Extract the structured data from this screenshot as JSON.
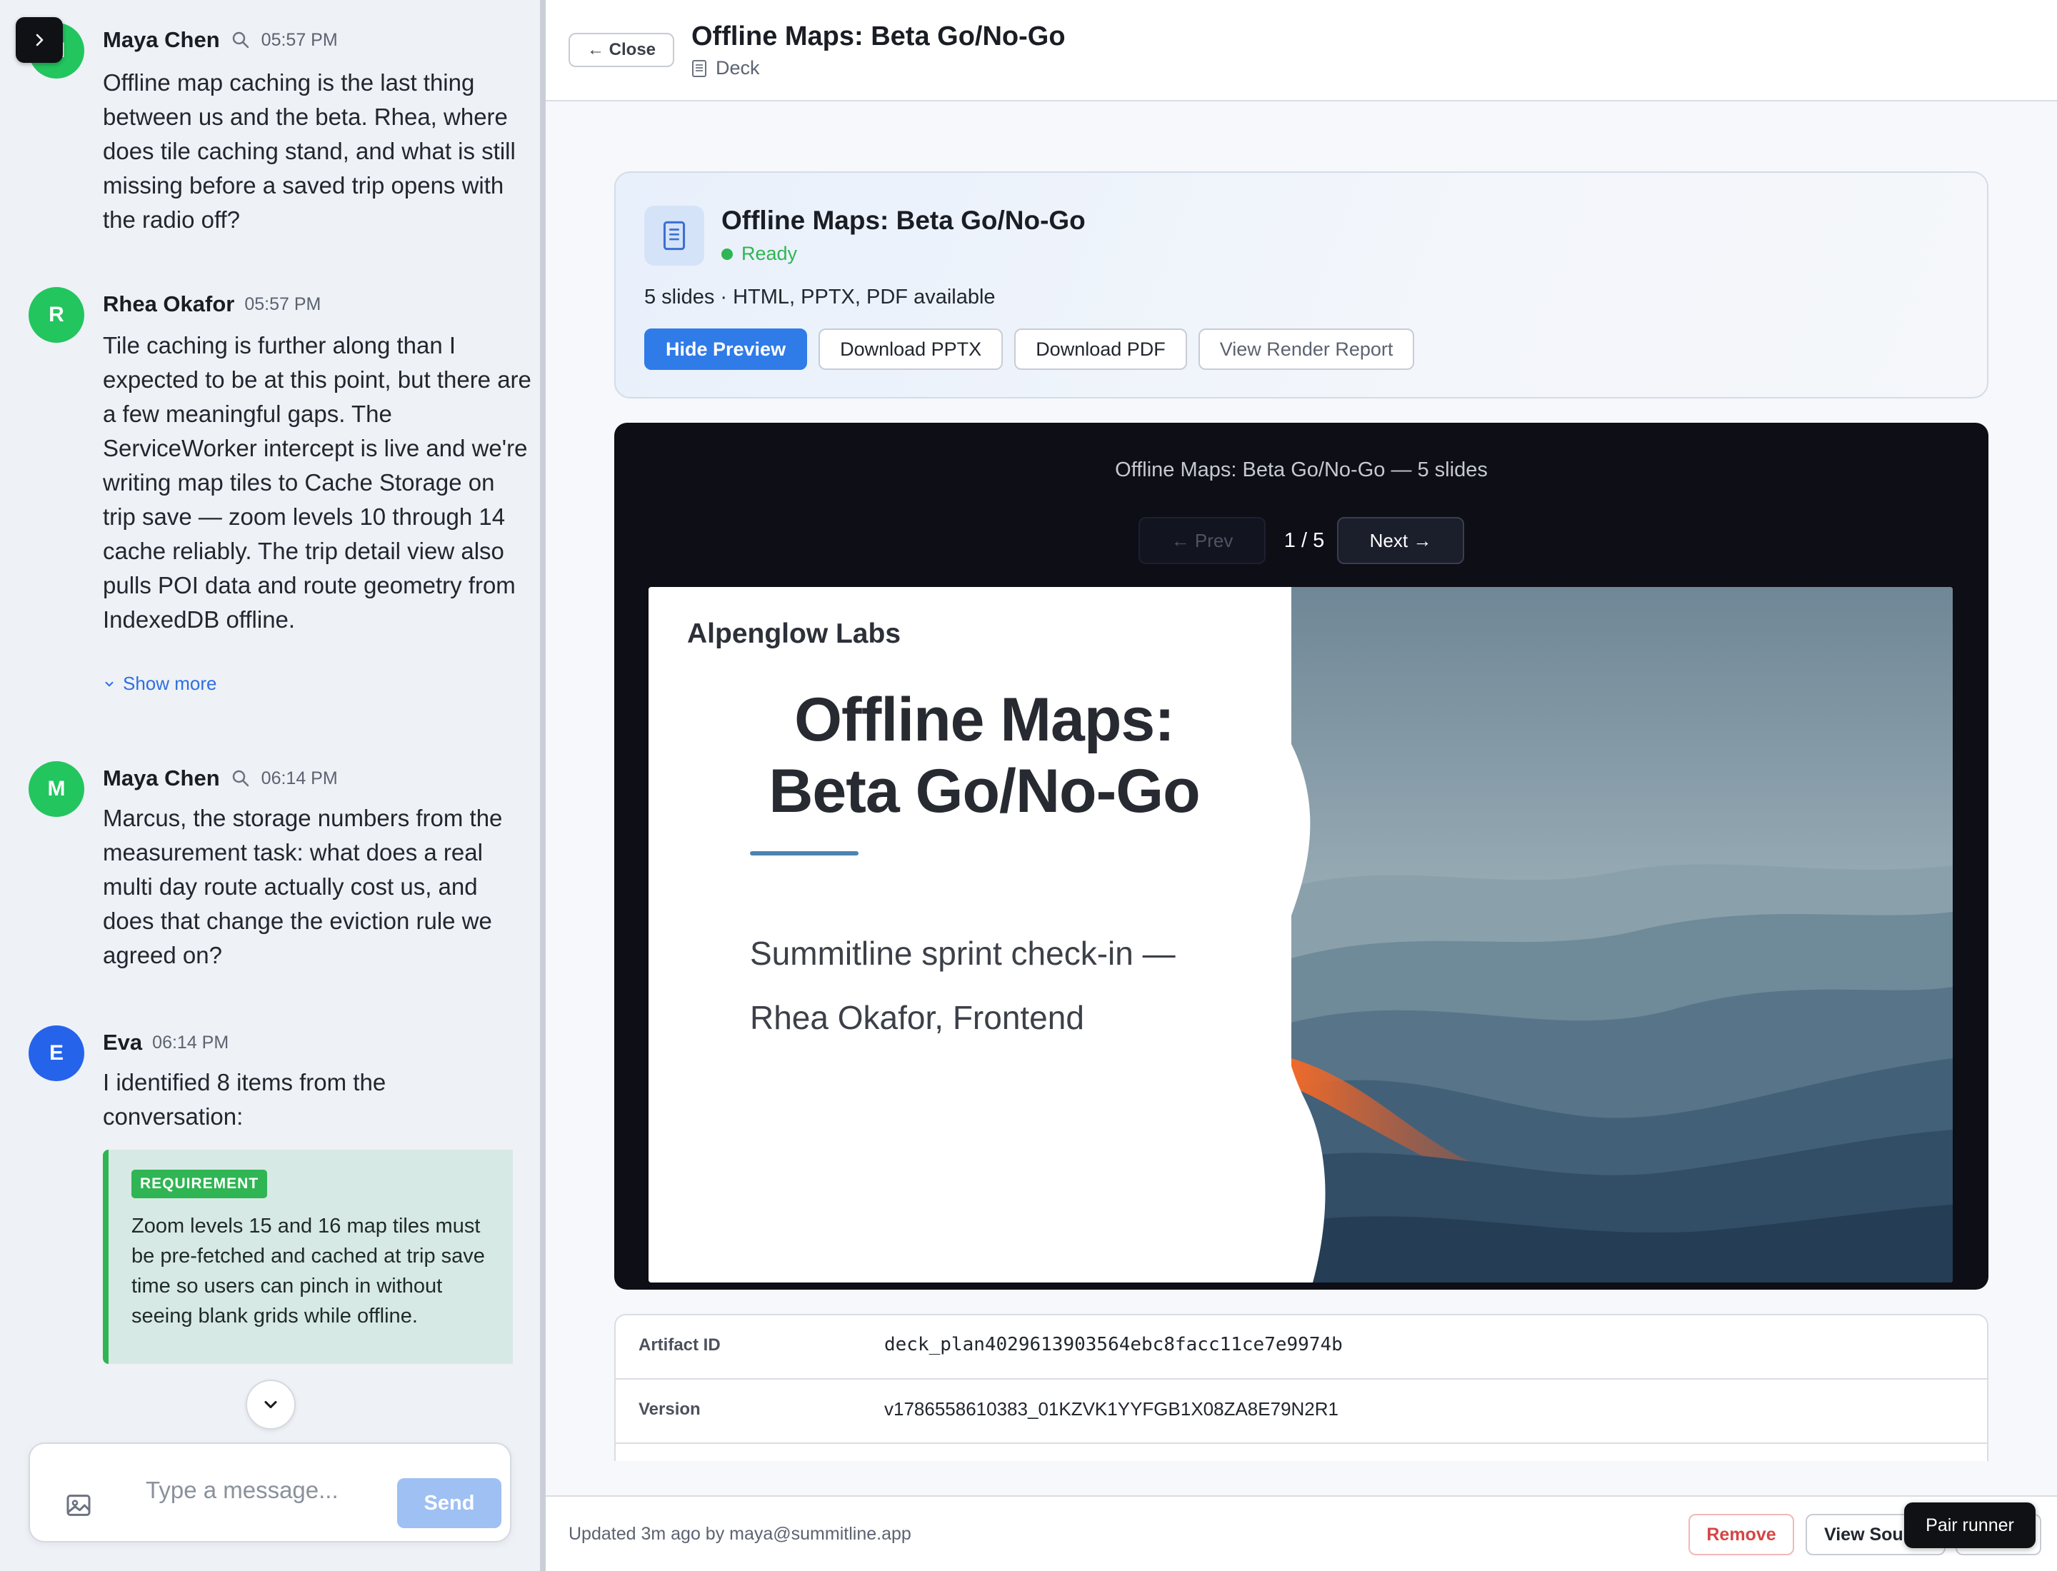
{
  "chat": {
    "messages": [
      {
        "author": "Maya Chen",
        "avatar": "M",
        "avatar_color": "#22c55e",
        "time": "05:57 PM",
        "text": "Offline map caching is the last thing between us and the beta. Rhea, where does tile caching stand, and what is still missing before a saved trip opens with the radio off?"
      },
      {
        "author": "Rhea Okafor",
        "avatar": "R",
        "avatar_color": "#22c55e",
        "time": "05:57 PM",
        "text": "Tile caching is further along than I expected to be at this point, but there are a few meaningful gaps. The ServiceWorker intercept is live and we're writing map tiles to Cache Storage on trip save — zoom levels 10 through 14 cache reliably. The trip detail view also pulls POI data and route geometry from IndexedDB offline.",
        "show_more": "Show more"
      },
      {
        "author": "Maya Chen",
        "avatar": "M",
        "avatar_color": "#22c55e",
        "time": "06:14 PM",
        "text": "Marcus, the storage numbers from the measurement task: what does a real multi day route actually cost us, and does that change the eviction rule we agreed on?"
      },
      {
        "author": "Eva",
        "avatar": "E",
        "avatar_color": "#2563eb",
        "time": "06:14 PM",
        "text": "I identified 8 items from the conversation:"
      }
    ],
    "requirement": {
      "badge": "REQUIREMENT",
      "text": "Zoom levels 15 and 16 map tiles must be pre-fetched and cached at trip save time so users can pinch in without seeing blank grids while offline."
    },
    "composer": {
      "placeholder": "Type a message...",
      "send_label": "Send"
    }
  },
  "header": {
    "close_label": "← Close",
    "title": "Offline Maps: Beta Go/No-Go",
    "type_label": "Deck"
  },
  "artifact": {
    "title": "Offline Maps: Beta Go/No-Go",
    "status": "Ready",
    "summary": "5 slides · HTML, PPTX, PDF available",
    "actions": {
      "hide_preview": "Hide Preview",
      "download_pptx": "Download PPTX",
      "download_pdf": "Download PDF",
      "view_render_report": "View Render Report"
    }
  },
  "viewer": {
    "title": "Offline Maps: Beta Go/No-Go — 5 slides",
    "prev_label": "← Prev",
    "next_label": "Next →",
    "page_indicator": "1 / 5",
    "slide": {
      "brand": "Alpenglow Labs",
      "title": "Offline Maps: Beta Go/No-Go",
      "subtitle_line1": "Summitline sprint check-in —",
      "subtitle_line2": "Rhea Okafor, Frontend"
    }
  },
  "meta": {
    "rows": [
      {
        "key": "Artifact ID",
        "value": "deck_plan4029613903564ebc8facc11ce7e9974b"
      },
      {
        "key": "Version",
        "value": "v1786558610383_01KZVK1YYFGB1X08ZA8E79N2R1"
      }
    ]
  },
  "footer": {
    "updated_text": "Updated 3m ago by maya@summitline.app",
    "remove_label": "Remove",
    "view_source_label": "View Source",
    "pair_runner_label": "Pair runner"
  },
  "colors": {
    "accent": "#2f7be8",
    "ready": "#2fb553",
    "danger": "#d64545",
    "viewer_bg": "#0d0e16"
  },
  "icons": {
    "toggle": "chevron-right-icon",
    "search": "search-icon",
    "deck": "document-icon",
    "scroll": "chevron-down-icon",
    "attach": "image-icon"
  }
}
